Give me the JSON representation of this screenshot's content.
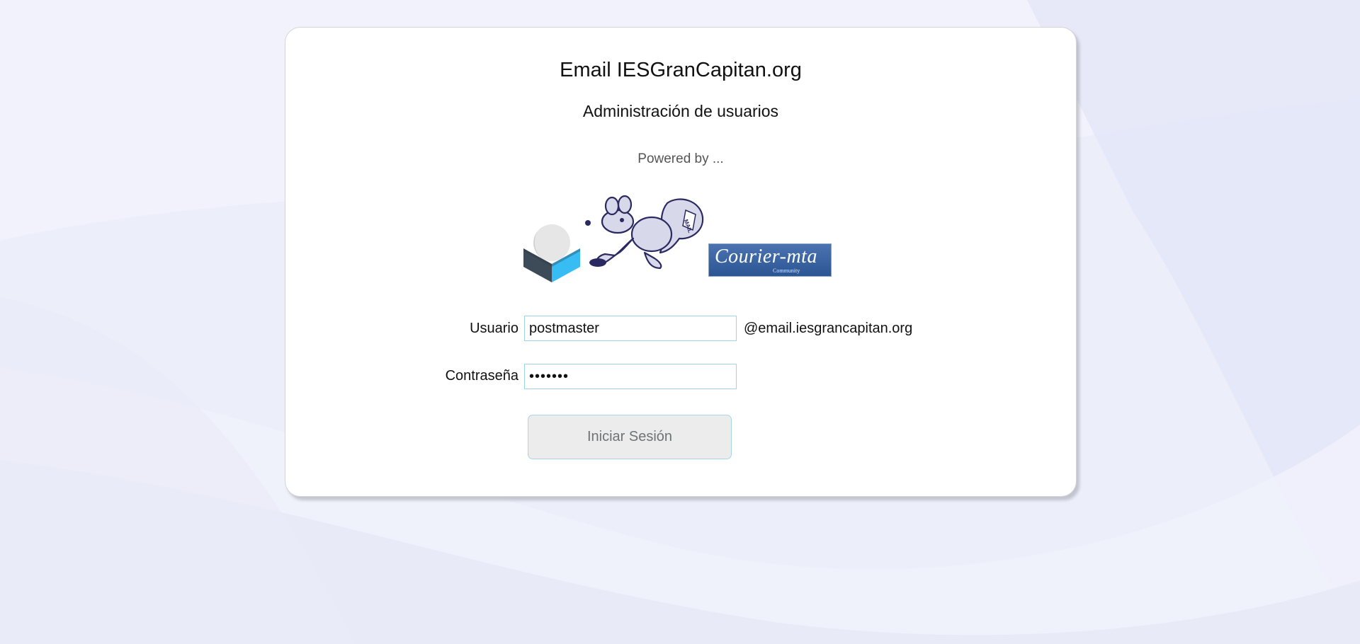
{
  "header": {
    "title": "Email IESGranCapitan.org",
    "subtitle": "Administración de usuarios",
    "powered_by": "Powered by ..."
  },
  "logos": {
    "roundcube": "roundcube-logo",
    "squirrelmail": "squirrelmail-logo",
    "courier": {
      "text": "Courier-mta",
      "subtext": "Community"
    }
  },
  "form": {
    "username_label": "Usuario",
    "username_value": "postmaster",
    "domain_suffix": "@email.iesgrancapitan.org",
    "password_label": "Contraseña",
    "password_value": "•••••••",
    "submit_label": "Iniciar Sesión"
  },
  "colors": {
    "background": "#eceefa",
    "card": "#ffffff",
    "input_border": "#9fd3e8",
    "button_bg": "#ececec",
    "roundcube_blue": "#37bdf4",
    "roundcube_dark": "#3c4b57",
    "courier_blue": "#3b64a3"
  }
}
